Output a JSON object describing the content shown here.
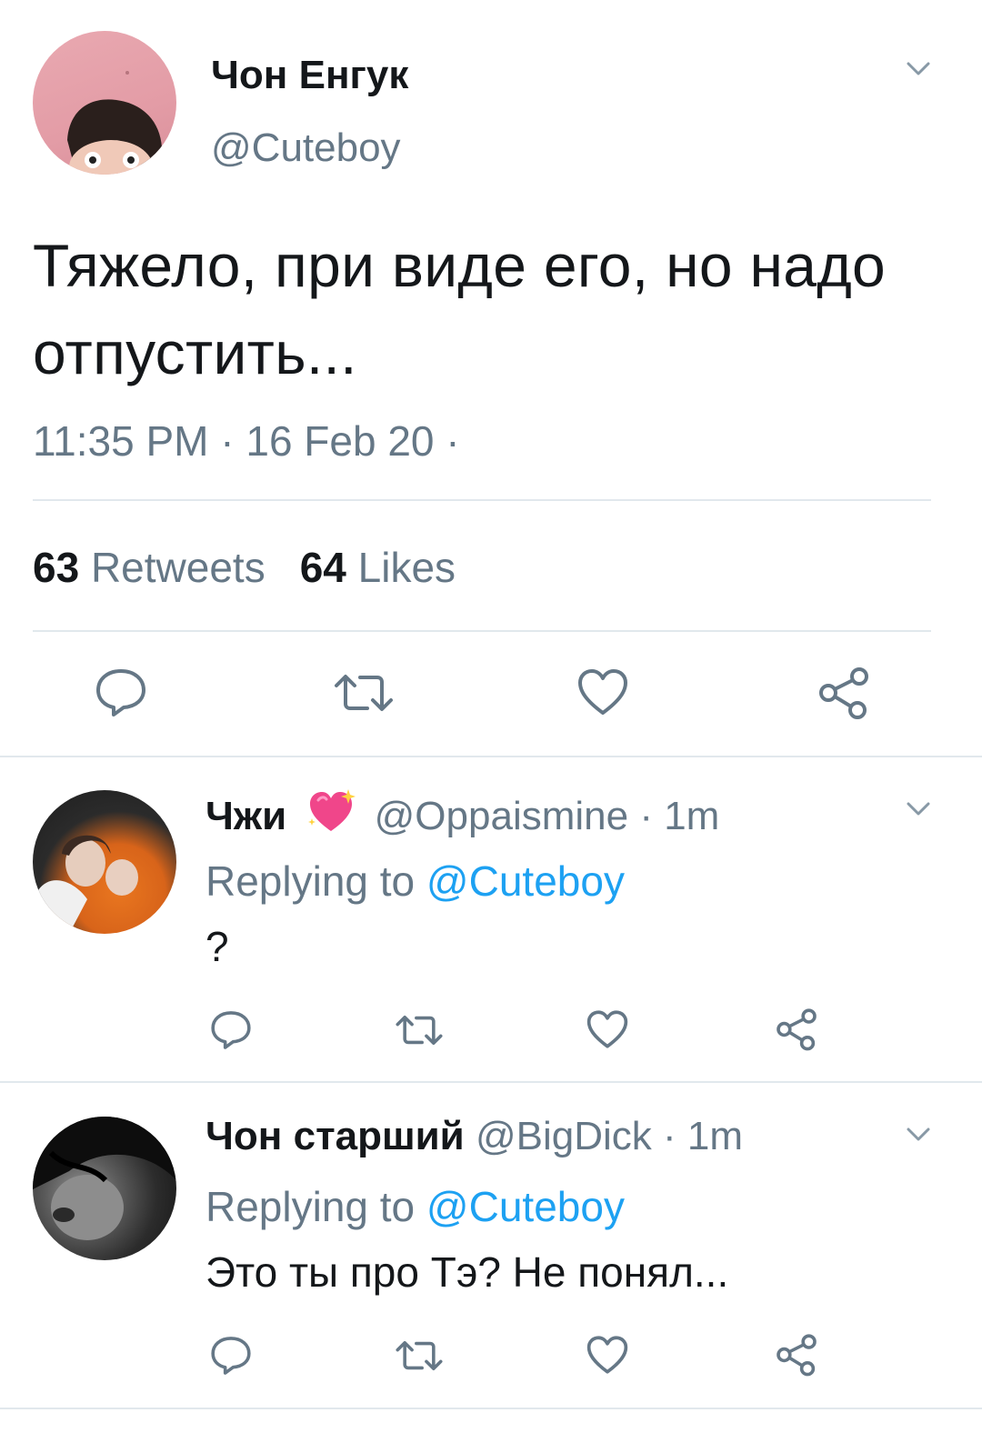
{
  "tweet": {
    "author_name": "Чон Енгук",
    "handle": "@Cuteboy",
    "text": "Тяжело, при виде его, но надо отпустить...",
    "timestamp": "11:35 PM · 16 Feb 20 ·",
    "retweets_count": "63",
    "retweets_label": "Retweets",
    "likes_count": "64",
    "likes_label": "Likes"
  },
  "replies": [
    {
      "author_name": "Чжи",
      "emoji": "sparkling-heart-emoji",
      "handle": "@Oppaismine",
      "time": "· 1m",
      "replying_to_label": "Replying to",
      "replying_to_handle": "@Cuteboy",
      "text": "?"
    },
    {
      "author_name": "Чон старший",
      "handle": "@BigDick",
      "time": "· 1m",
      "replying_to_label": "Replying to",
      "replying_to_handle": "@Cuteboy",
      "text": "Это ты про Тэ? Не понял..."
    }
  ],
  "icons": {
    "reply": "reply-icon",
    "retweet": "retweet-icon",
    "like": "heart-icon",
    "share": "share-icon",
    "more": "chevron-down-icon"
  },
  "colors": {
    "text_primary": "#14171a",
    "text_secondary": "#657786",
    "link": "#1da1f2",
    "divider": "#e1e8ed",
    "icon": "#657786"
  }
}
